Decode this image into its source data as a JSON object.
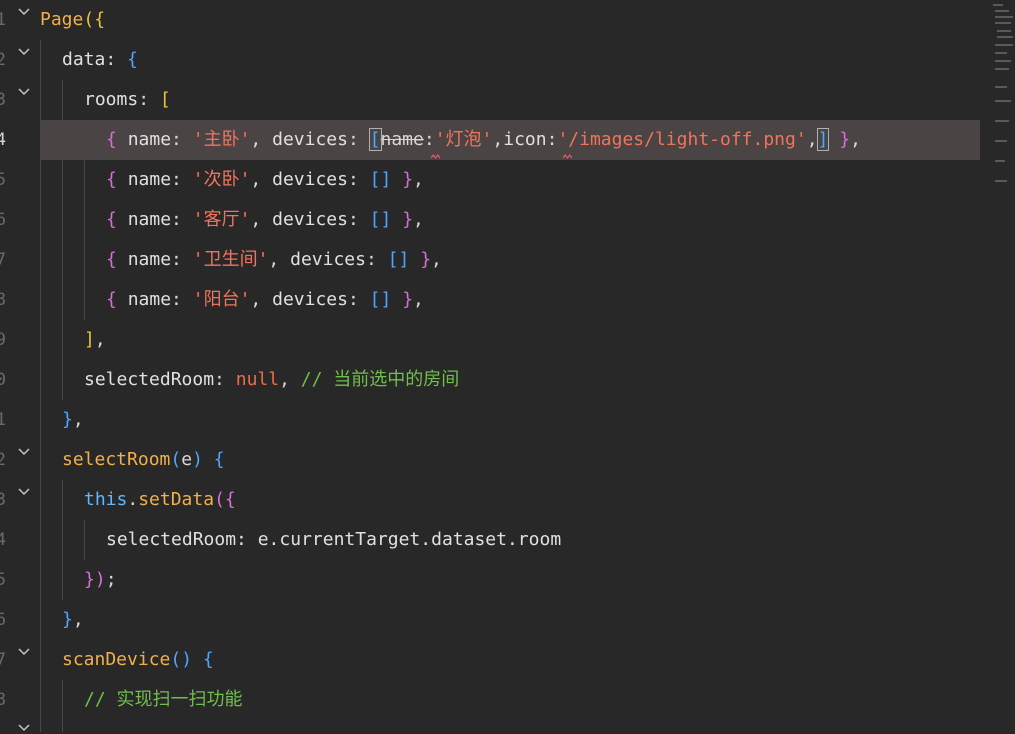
{
  "editor": {
    "line_numbers": [
      "1",
      "2",
      "3",
      "4",
      "5",
      "6",
      "7",
      "8",
      "9",
      "0",
      "1",
      "2",
      "3",
      "4",
      "5",
      "6",
      "7",
      "8"
    ],
    "active_line_number": "4"
  },
  "code": {
    "l1": {
      "page": "Page",
      "open": "({"
    },
    "l2": {
      "key": "data",
      "colon": ": ",
      "brace": "{"
    },
    "l3": {
      "key": "rooms",
      "colon": ": ",
      "bracket": "["
    },
    "l4": {
      "ob": "{ ",
      "name_key": "name",
      "sep1": ": ",
      "name_val": "'主卧'",
      "comma1": ", ",
      "dev_key": "devices",
      "sep2": ": ",
      "arr_open": "[",
      "struck": "name",
      "colon3": ":",
      "v1": "'灯泡'",
      "comma2": ",",
      "icon_key": "icon",
      "colon4": ":",
      "v2": "'/images/light-off.png'",
      "comma3": ",",
      "arr_close": "]",
      "tail_sp": " ",
      "cb": "}",
      "tail": ","
    },
    "l5": {
      "ob": "{ ",
      "name_key": "name",
      "sep1": ": ",
      "name_val": "'次卧'",
      "comma1": ", ",
      "dev_key": "devices",
      "sep2": ": ",
      "arr": "[]",
      "sp": " ",
      "cb": "}",
      "tail": ","
    },
    "l6": {
      "ob": "{ ",
      "name_key": "name",
      "sep1": ": ",
      "name_val": "'客厅'",
      "comma1": ", ",
      "dev_key": "devices",
      "sep2": ": ",
      "arr": "[]",
      "sp": " ",
      "cb": "}",
      "tail": ","
    },
    "l7": {
      "ob": "{ ",
      "name_key": "name",
      "sep1": ": ",
      "name_val": "'卫生间'",
      "comma1": ", ",
      "dev_key": "devices",
      "sep2": ": ",
      "arr": "[]",
      "sp": " ",
      "cb": "}",
      "tail": ","
    },
    "l8": {
      "ob": "{ ",
      "name_key": "name",
      "sep1": ": ",
      "name_val": "'阳台'",
      "comma1": ", ",
      "dev_key": "devices",
      "sep2": ": ",
      "arr": "[]",
      "sp": " ",
      "cb": "}",
      "tail": ","
    },
    "l9": {
      "close": "]",
      "tail": ","
    },
    "l10": {
      "key": "selectedRoom",
      "colon": ": ",
      "val": "null",
      "comma": ", ",
      "comment": "// 当前选中的房间"
    },
    "l11": {
      "close": "}",
      "tail": ","
    },
    "l12": {
      "fn": "selectRoom",
      "po": "(",
      "arg": "e",
      "pc": ")",
      "sp": " ",
      "brace": "{"
    },
    "l13": {
      "this": "this",
      "dot": ".",
      "fn": "setData",
      "open": "({"
    },
    "l14": {
      "text": "selectedRoom: e.currentTarget.dataset.room"
    },
    "l15": {
      "close": "})",
      "tail": ";"
    },
    "l16": {
      "close": "}",
      "tail": ","
    },
    "l17": {
      "fn": "scanDevice",
      "parens": "()",
      "sp": " ",
      "brace": "{"
    },
    "l18": {
      "comment": "// 实现扫一扫功能"
    }
  },
  "colors": {
    "background": "#282828",
    "current_line": "#4a4444",
    "string": "#f2735b",
    "function": "#f0b04c",
    "comment": "#6fbf4a",
    "keyword_this": "#63b6ff"
  }
}
